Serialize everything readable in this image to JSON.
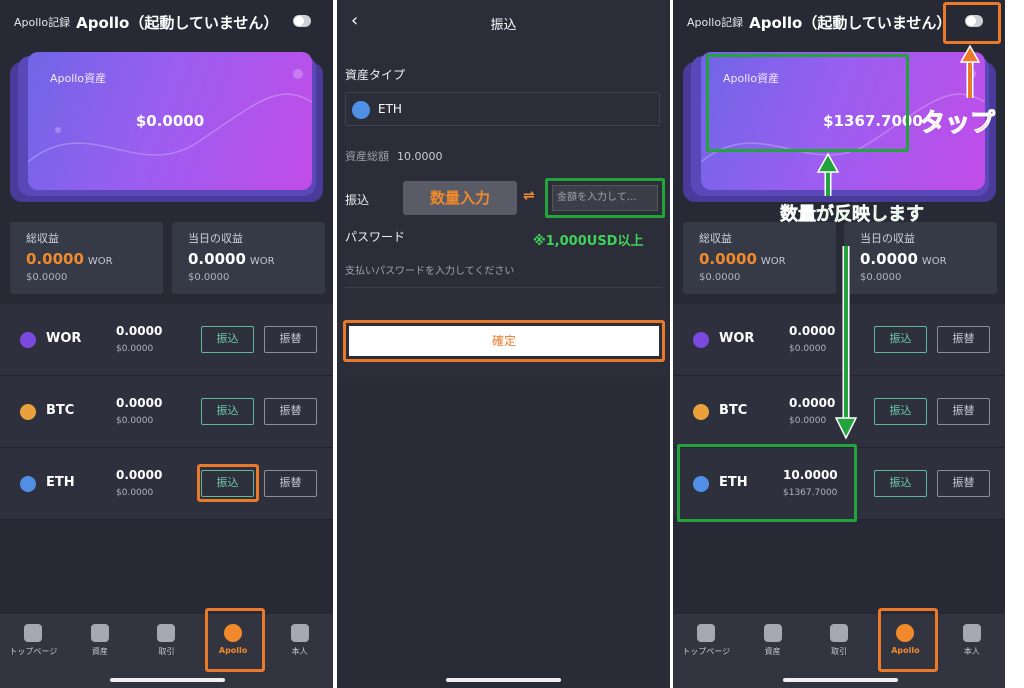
{
  "screen_left": {
    "header": {
      "record_label": "Apollo記録",
      "title": "Apollo（起動していません）"
    },
    "card": {
      "label": "Apollo資産",
      "amount": "$0.0000"
    },
    "stats": [
      {
        "title": "総収益",
        "value": "0.0000",
        "unit": "WOR",
        "usd": "$0.0000"
      },
      {
        "title": "当日の収益",
        "value": "0.0000",
        "unit": "WOR",
        "usd": "$0.0000"
      }
    ],
    "coins": [
      {
        "name": "WOR",
        "qty": "0.0000",
        "usd": "$0.0000",
        "deposit": "振込",
        "transfer": "振替"
      },
      {
        "name": "BTC",
        "qty": "0.0000",
        "usd": "$0.0000",
        "deposit": "振込",
        "transfer": "振替"
      },
      {
        "name": "ETH",
        "qty": "0.0000",
        "usd": "$0.0000",
        "deposit": "振込",
        "transfer": "振替"
      }
    ],
    "nav": [
      "トップページ",
      "資産",
      "取引",
      "Apollo",
      "本人"
    ]
  },
  "screen_middle": {
    "back_icon": "‹",
    "title": "振込",
    "asset_type_label": "資産タイプ",
    "asset_selected": "ETH",
    "balance_label": "資産総額",
    "balance_value": "10.0000",
    "deposit_label": "振込",
    "amount_annotation": "数量入力",
    "arrows": "⇌",
    "amount_placeholder": "金額を入力して…",
    "minimum_note": "※1,000USD以上",
    "password_label": "パスワード",
    "password_placeholder": "支払いパスワードを入力してください",
    "confirm_button": "確定"
  },
  "screen_right": {
    "header": {
      "record_label": "Apollo記録",
      "title": "Apollo（起動していません）"
    },
    "card": {
      "label": "Apollo資産",
      "amount": "$1367.7000"
    },
    "tap_annotation": "タップ",
    "reflect_annotation": "数量が反映します",
    "stats": [
      {
        "title": "総収益",
        "value": "0.0000",
        "unit": "WOR",
        "usd": "$0.0000"
      },
      {
        "title": "当日の収益",
        "value": "0.0000",
        "unit": "WOR",
        "usd": "$0.0000"
      }
    ],
    "coins": [
      {
        "name": "WOR",
        "qty": "0.0000",
        "usd": "$0.0000",
        "deposit": "振込",
        "transfer": "振替"
      },
      {
        "name": "BTC",
        "qty": "0.0000",
        "usd": "$0.0000",
        "deposit": "振込",
        "transfer": "振替"
      },
      {
        "name": "ETH",
        "qty": "10.0000",
        "usd": "$1367.7000",
        "deposit": "振込",
        "transfer": "振替"
      }
    ],
    "nav": [
      "トップページ",
      "資産",
      "取引",
      "Apollo",
      "本人"
    ]
  },
  "colors": {
    "accent_orange": "#ea7a2a",
    "accent_green": "#23a33c",
    "card_gradient_start": "#6f66e6",
    "card_gradient_end": "#c24ce8"
  }
}
